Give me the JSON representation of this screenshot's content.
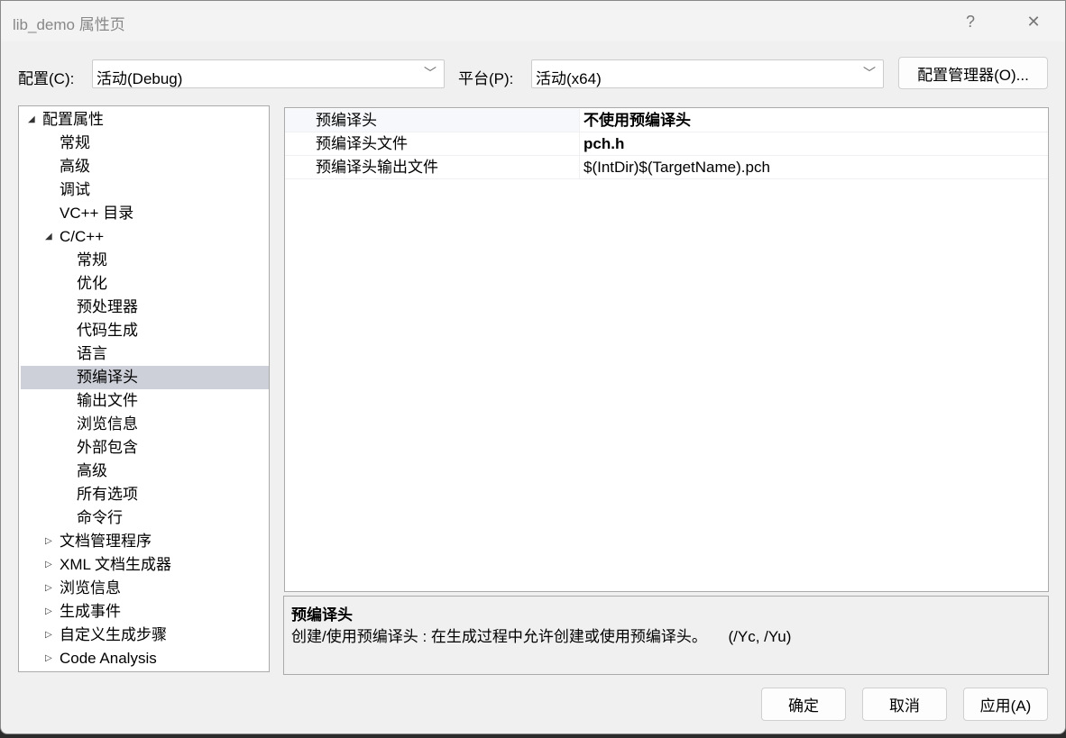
{
  "window": {
    "title": "lib_demo 属性页",
    "help_icon": "?",
    "close_icon": "✕"
  },
  "config": {
    "label": "配置(C):",
    "value": "活动(Debug)"
  },
  "platform": {
    "label": "平台(P):",
    "value": "活动(x64)"
  },
  "config_manager_label": "配置管理器(O)...",
  "tree": [
    {
      "label": "配置属性",
      "level": 0,
      "expander": "expanded"
    },
    {
      "label": "常规",
      "level": 1
    },
    {
      "label": "高级",
      "level": 1
    },
    {
      "label": "调试",
      "level": 1
    },
    {
      "label": "VC++ 目录",
      "level": 1
    },
    {
      "label": "C/C++",
      "level": 1,
      "expander": "expanded"
    },
    {
      "label": "常规",
      "level": 2
    },
    {
      "label": "优化",
      "level": 2
    },
    {
      "label": "预处理器",
      "level": 2
    },
    {
      "label": "代码生成",
      "level": 2
    },
    {
      "label": "语言",
      "level": 2
    },
    {
      "label": "预编译头",
      "level": 2,
      "selected": true
    },
    {
      "label": "输出文件",
      "level": 2
    },
    {
      "label": "浏览信息",
      "level": 2
    },
    {
      "label": "外部包含",
      "level": 2
    },
    {
      "label": "高级",
      "level": 2
    },
    {
      "label": "所有选项",
      "level": 2
    },
    {
      "label": "命令行",
      "level": 2
    },
    {
      "label": "文档管理程序",
      "level": 1,
      "expander": "collapsed"
    },
    {
      "label": "XML 文档生成器",
      "level": 1,
      "expander": "collapsed"
    },
    {
      "label": "浏览信息",
      "level": 1,
      "expander": "collapsed"
    },
    {
      "label": "生成事件",
      "level": 1,
      "expander": "collapsed"
    },
    {
      "label": "自定义生成步骤",
      "level": 1,
      "expander": "collapsed"
    },
    {
      "label": "Code Analysis",
      "level": 1,
      "expander": "collapsed"
    }
  ],
  "properties": [
    {
      "name": "预编译头",
      "value": "不使用预编译头",
      "bold": true
    },
    {
      "name": "预编译头文件",
      "value": "pch.h",
      "bold": true
    },
    {
      "name": "预编译头输出文件",
      "value": "$(IntDir)$(TargetName).pch",
      "bold": false
    }
  ],
  "description": {
    "title": "预编译头",
    "text": "创建/使用预编译头 : 在生成过程中允许创建或使用预编译头。     (/Yc, /Yu)"
  },
  "buttons": {
    "ok": "确定",
    "cancel": "取消",
    "apply": "应用(A)"
  }
}
